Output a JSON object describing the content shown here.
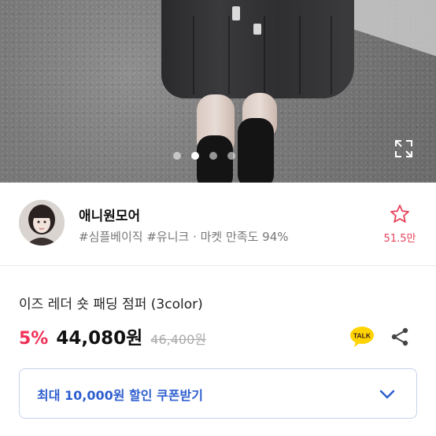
{
  "hero": {
    "carousel_dots": 4,
    "active_dot": 1
  },
  "shop": {
    "name": "애니원모어",
    "tags": "#심플베이직 #유니크 · 마켓 만족도 94%",
    "like_count": "51.5만"
  },
  "product": {
    "title": "이즈 레더 숏 패딩 점퍼 (3color)",
    "discount": "5%",
    "price": "44,080원",
    "original_price": "46,400원"
  },
  "actions": {
    "talk_label": "TALK"
  },
  "coupon": {
    "label": "최대 10,000원 할인 쿠폰받기"
  },
  "colors": {
    "accent_pink": "#ef2f56",
    "coupon_blue": "#2f5fcf",
    "talk_yellow": "#ffd400"
  }
}
